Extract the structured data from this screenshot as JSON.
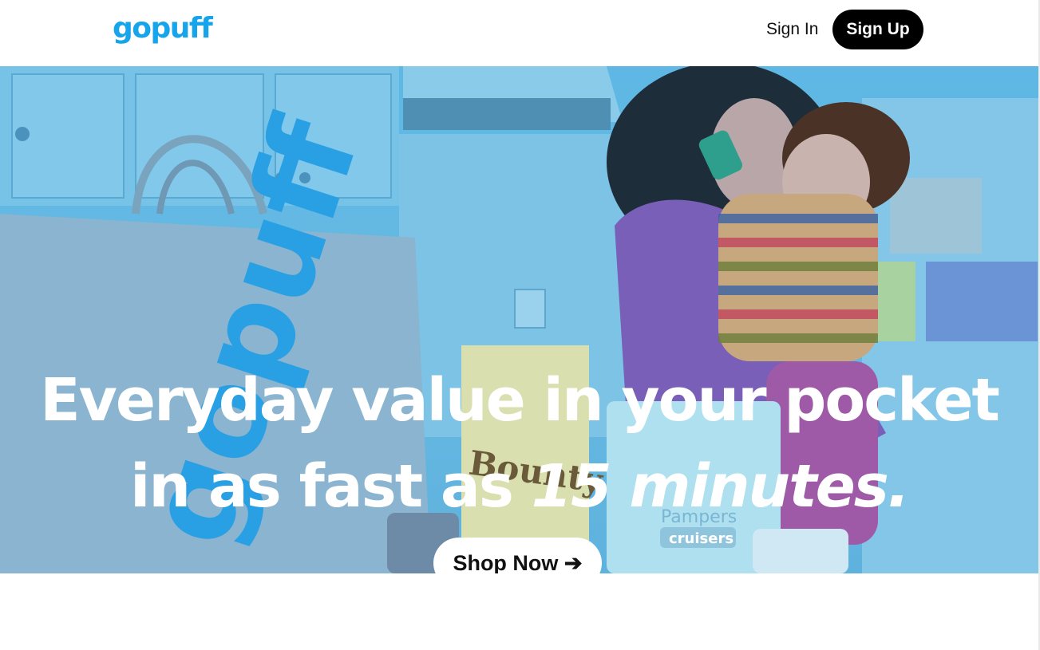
{
  "header": {
    "logo_text": "gopuff",
    "sign_in_label": "Sign In",
    "sign_up_label": "Sign Up"
  },
  "hero": {
    "headline_line1": "Everyday value in your pocket",
    "headline_line2_prefix": "in as fast as ",
    "headline_line2_emphasis": "15 minutes.",
    "cta_label": "Shop Now ➔",
    "bag_text": "gopuff",
    "product_labels": [
      "Bounty",
      "Pampers",
      "cruisers"
    ]
  },
  "colors": {
    "brand_blue": "#16a5ea",
    "hero_tint": "#5eb7e4",
    "signup_bg": "#000000"
  }
}
